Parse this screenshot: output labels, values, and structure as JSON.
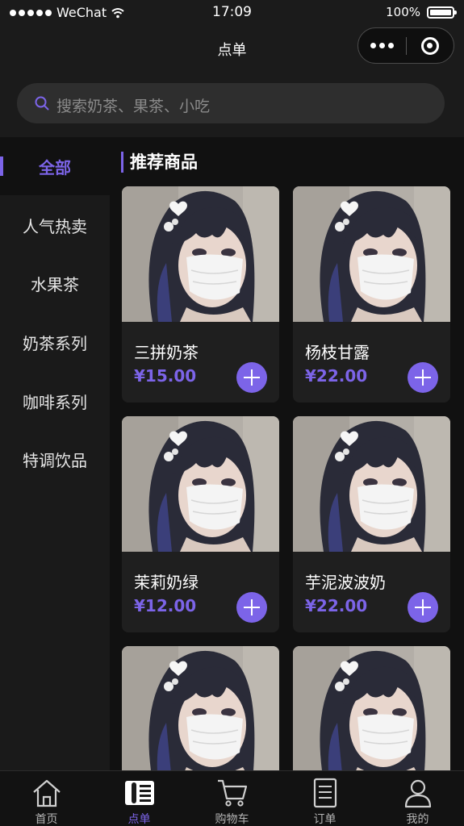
{
  "status_bar": {
    "carrier": "WeChat",
    "time": "17:09",
    "battery": "100%"
  },
  "nav": {
    "title": "点单"
  },
  "search": {
    "placeholder": "搜索奶茶、果茶、小吃"
  },
  "sidebar": {
    "items": [
      {
        "label": "全部",
        "active": true
      },
      {
        "label": "人气热卖"
      },
      {
        "label": "水果茶"
      },
      {
        "label": "奶茶系列"
      },
      {
        "label": "咖啡系列"
      },
      {
        "label": "特调饮品"
      }
    ]
  },
  "main": {
    "section_title": "推荐商品",
    "products": [
      {
        "name": "三拼奶茶",
        "price": "¥15.00"
      },
      {
        "name": "杨枝甘露",
        "price": "¥22.00"
      },
      {
        "name": "茉莉奶绿",
        "price": "¥12.00"
      },
      {
        "name": "芋泥波波奶",
        "price": "¥22.00"
      },
      {
        "name": "",
        "price": ""
      },
      {
        "name": "",
        "price": ""
      }
    ]
  },
  "tabbar": {
    "items": [
      {
        "label": "首页",
        "icon": "home-icon"
      },
      {
        "label": "点单",
        "icon": "menu-icon",
        "active": true
      },
      {
        "label": "购物车",
        "icon": "cart-icon"
      },
      {
        "label": "订单",
        "icon": "order-icon"
      },
      {
        "label": "我的",
        "icon": "user-icon"
      }
    ]
  },
  "colors": {
    "accent": "#7c64e8",
    "background": "#111111",
    "card": "#1f1f1f"
  }
}
